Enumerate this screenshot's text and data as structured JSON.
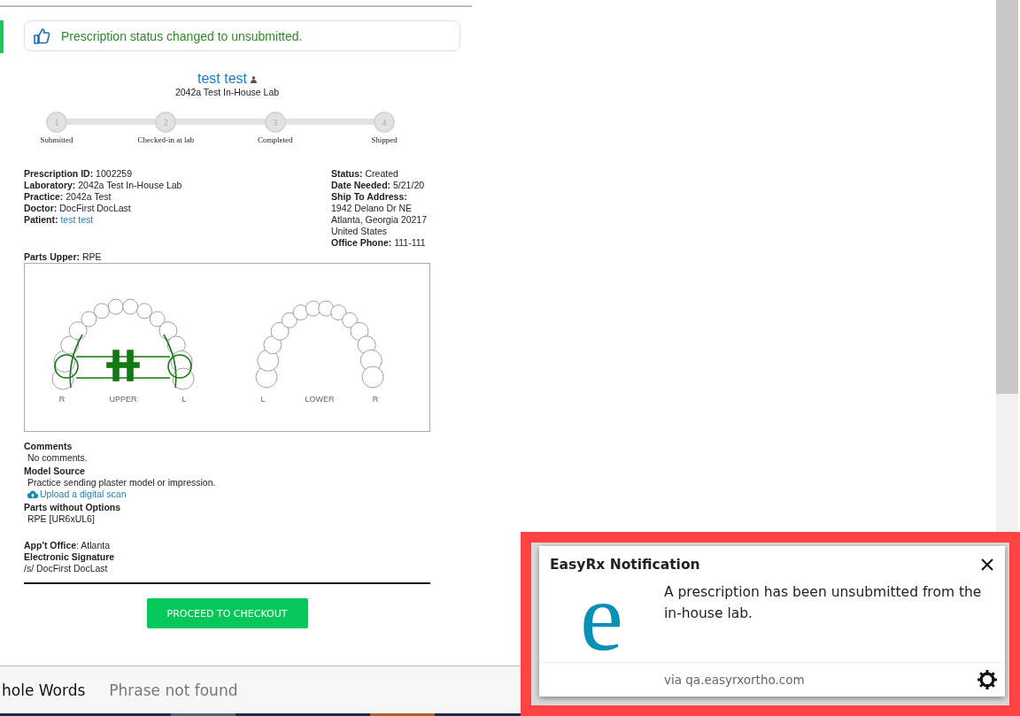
{
  "alert": {
    "text": "Prescription status changed to unsubmitted."
  },
  "patient": {
    "name": "test test",
    "lab": "2042a Test In-House Lab"
  },
  "steps": [
    {
      "number": "1",
      "label": "Submitted",
      "completed": false
    },
    {
      "number": "2",
      "label": "Checked-in at lab",
      "completed": false
    },
    {
      "number": "3",
      "label": "Completed",
      "completed": false
    },
    {
      "number": "4",
      "label": "Shipped",
      "completed": false
    }
  ],
  "details_left": [
    {
      "label": "Prescription ID:",
      "value": "1002259",
      "kind": "text"
    },
    {
      "label": "Laboratory:",
      "value": "2042a Test In-House Lab",
      "kind": "text"
    },
    {
      "label": "Practice:",
      "value": "2042a Test",
      "kind": "text"
    },
    {
      "label": "Doctor:",
      "value": "DocFirst DocLast",
      "kind": "text"
    },
    {
      "label": "Patient:",
      "value": "test test",
      "kind": "link"
    }
  ],
  "details_right": [
    {
      "label": "Status:",
      "value": "Created",
      "kind": "text"
    },
    {
      "label": "Date Needed:",
      "value": "5/21/20",
      "kind": "text"
    },
    {
      "label": "Ship To Address:",
      "kind": "heading"
    },
    {
      "value": "1942 Delano Dr NE",
      "kind": "line"
    },
    {
      "value": "Atlanta, Georgia 20217",
      "kind": "line"
    },
    {
      "value": "United States",
      "kind": "line"
    },
    {
      "label": "Office Phone:",
      "value": "111-111",
      "kind": "text"
    }
  ],
  "parts_upper": {
    "label": "Parts Upper:",
    "value": "RPE"
  },
  "arches": [
    {
      "kind": "upper",
      "labels": [
        "R",
        "UPPER",
        "L"
      ]
    },
    {
      "kind": "lower",
      "labels": [
        "L",
        "LOWER",
        "R"
      ]
    }
  ],
  "comments": {
    "label": "Comments",
    "text": "No comments."
  },
  "model_source": {
    "label": "Model Source",
    "text": "Practice sending plaster model or impression.",
    "link": "Upload a digital scan"
  },
  "parts_without_options": {
    "label": "Parts without Options",
    "text": "RPE [UR6xUL6]"
  },
  "appt_office": {
    "label": "App't Office",
    "value": ": Atlanta"
  },
  "signature": {
    "label": "Electronic Signature",
    "text": "/s/ DocFirst DocLast"
  },
  "checkout_button": "PROCEED TO CHECKOUT",
  "find_bar": {
    "option": "hole Words",
    "status": "Phrase not found"
  },
  "notification": {
    "title": "EasyRx Notification",
    "logo": "e",
    "message": "A prescription has been unsubmitted from the in-house lab.",
    "source": "via qa.easyrxortho.com"
  }
}
